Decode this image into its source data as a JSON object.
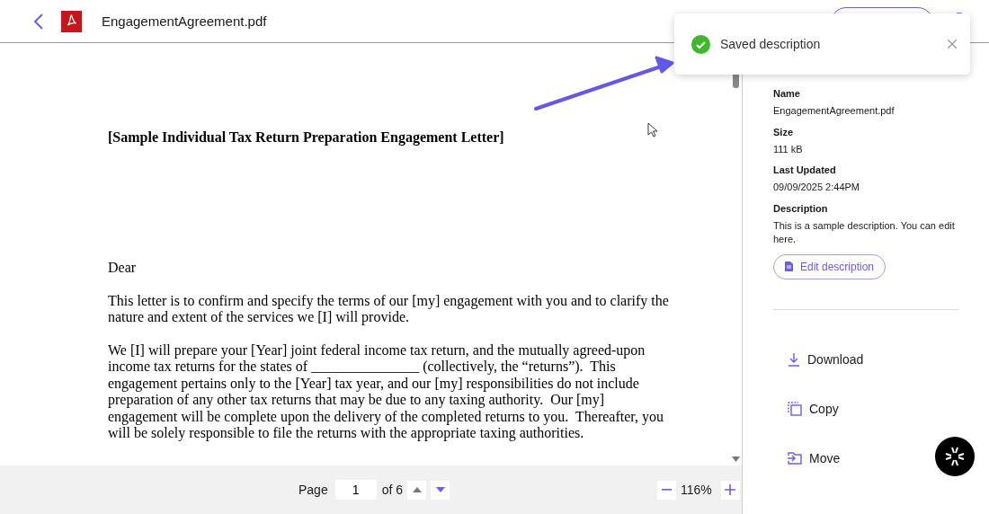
{
  "header": {
    "file_name": "EngagementAgreement.pdf"
  },
  "document": {
    "title": "[Sample Individual Tax Return Preparation Engagement Letter]",
    "salutation": "Dear",
    "paragraphs": [
      "This letter is to confirm and specify the terms of our [my] engagement with you and to clarify the nature and extent of the services we [I] will provide.",
      "We [I] will prepare your [Year] joint federal income tax return, and the mutually agreed-upon income tax returns for the states of _______________ (collectively, the “returns”).  This engagement pertains only to the [Year] tax year, and our [my] responsibilities do not include preparation of any other tax returns that may be due to any taxing authority.  Our [my] engagement will be complete upon the delivery of the completed returns to you.  Thereafter, you will be solely responsible to file the returns with the appropriate taxing authorities."
    ]
  },
  "pager": {
    "label": "Page",
    "page": "1",
    "total": "of 6",
    "zoom": "116%"
  },
  "details": {
    "fields": [
      {
        "label": "Name",
        "value": "EngagementAgreement.pdf"
      },
      {
        "label": "Size",
        "value": "111 kB"
      },
      {
        "label": "Last Updated",
        "value": "09/09/2025 2:44PM"
      },
      {
        "label": "Description",
        "value": "This is a sample description. You can edit here."
      }
    ],
    "edit_button": "Edit description"
  },
  "actions": [
    {
      "label": "Download",
      "kind": "download"
    },
    {
      "label": "Copy",
      "kind": "copy"
    },
    {
      "label": "Move",
      "kind": "move"
    }
  ],
  "toast": {
    "message": "Saved description"
  }
}
